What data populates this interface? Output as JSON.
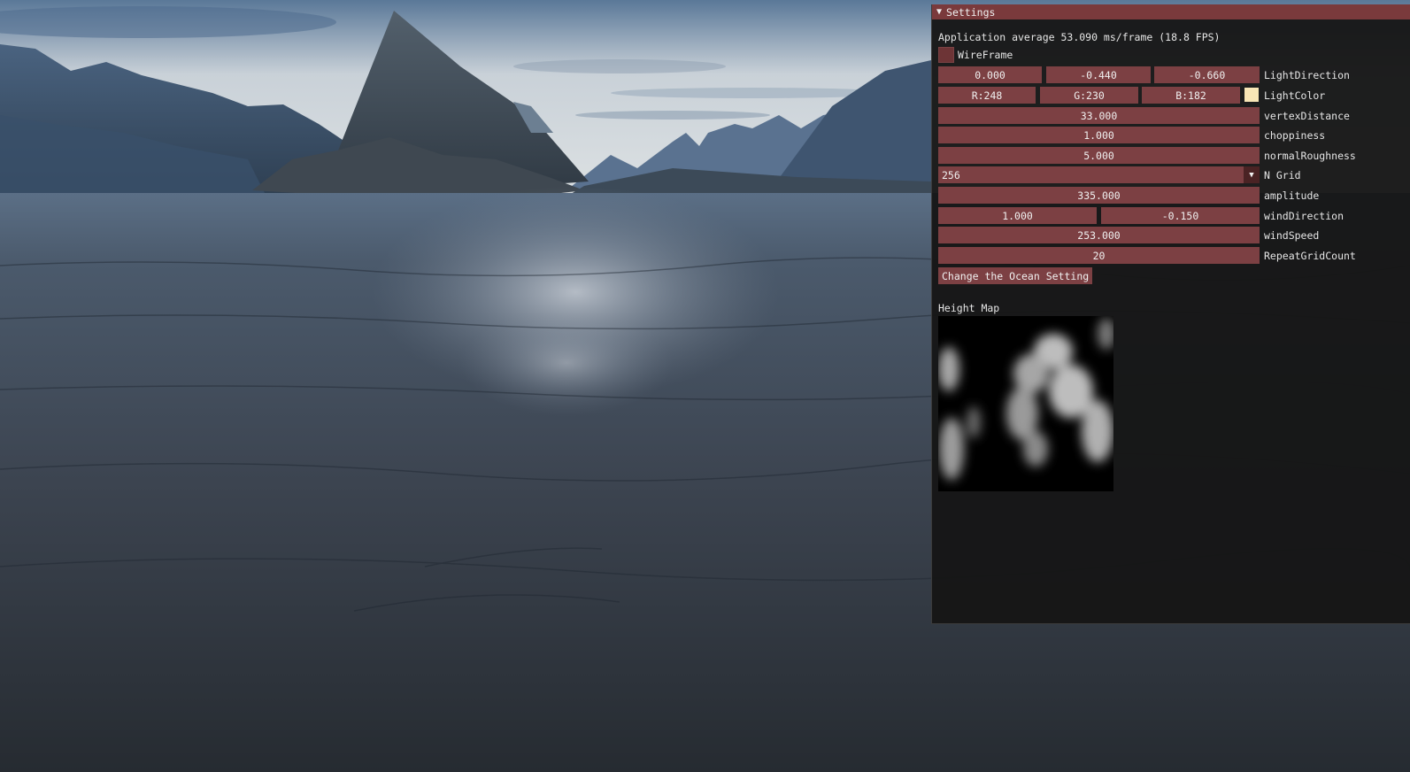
{
  "window": {
    "title": "Settings",
    "fps_text": "Application average 53.090 ms/frame (18.8 FPS)",
    "wireframe_label": "WireFrame",
    "wireframe_checked": false,
    "light_direction": {
      "x": "0.000",
      "y": "-0.440",
      "z": "-0.660",
      "label": "LightDirection"
    },
    "light_color": {
      "r": "R:248",
      "g": "G:230",
      "b": "B:182",
      "label": "LightColor",
      "swatch": "#f8e6b6"
    },
    "vertex_distance": {
      "value": "33.000",
      "label": "vertexDistance"
    },
    "choppiness": {
      "value": "1.000",
      "label": "choppiness"
    },
    "normal_roughness": {
      "value": "5.000",
      "label": "normalRoughness"
    },
    "n_grid": {
      "value": "256",
      "label": "N Grid"
    },
    "amplitude": {
      "value": "335.000",
      "label": "amplitude"
    },
    "wind_direction": {
      "x": "1.000",
      "y": "-0.150",
      "label": "windDirection"
    },
    "wind_speed": {
      "value": "253.000",
      "label": "windSpeed"
    },
    "repeat_grid_count": {
      "value": "20",
      "label": "RepeatGridCount"
    },
    "change_button": "Change the Ocean Setting",
    "height_map_label": "Height Map"
  },
  "colors": {
    "title_bar": "#7a3a3c",
    "frame_bg": "#7c4043",
    "window_bg": "#161616"
  }
}
